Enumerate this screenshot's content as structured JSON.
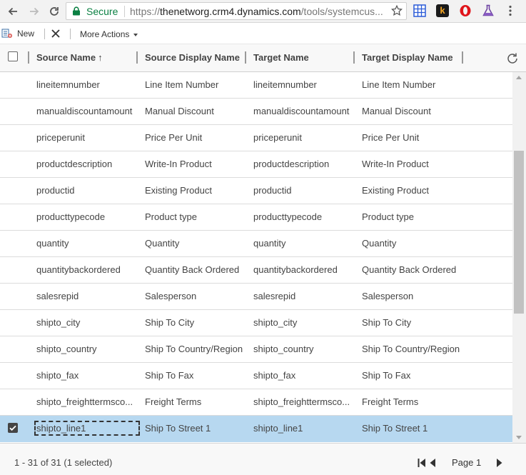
{
  "browser": {
    "security_label": "Secure",
    "url_scheme": "https://",
    "url_host": "thenetworg.crm4.dynamics.com",
    "url_path": "/tools/systemcus..."
  },
  "command_bar": {
    "new_label": "New",
    "more_actions_label": "More Actions"
  },
  "grid": {
    "columns": [
      {
        "label": "Source Name",
        "sort": "↑"
      },
      {
        "label": "Source Display Name"
      },
      {
        "label": "Target Name"
      },
      {
        "label": "Target Display Name"
      }
    ],
    "rows": [
      {
        "source_name": "lineitemnumber",
        "source_display": "Line Item Number",
        "target_name": "lineitemnumber",
        "target_display": "Line Item Number",
        "selected": false
      },
      {
        "source_name": "manualdiscountamount",
        "source_display": "Manual Discount",
        "target_name": "manualdiscountamount",
        "target_display": "Manual Discount",
        "selected": false
      },
      {
        "source_name": "priceperunit",
        "source_display": "Price Per Unit",
        "target_name": "priceperunit",
        "target_display": "Price Per Unit",
        "selected": false
      },
      {
        "source_name": "productdescription",
        "source_display": "Write-In Product",
        "target_name": "productdescription",
        "target_display": "Write-In Product",
        "selected": false
      },
      {
        "source_name": "productid",
        "source_display": "Existing Product",
        "target_name": "productid",
        "target_display": "Existing Product",
        "selected": false
      },
      {
        "source_name": "producttypecode",
        "source_display": "Product type",
        "target_name": "producttypecode",
        "target_display": "Product type",
        "selected": false
      },
      {
        "source_name": "quantity",
        "source_display": "Quantity",
        "target_name": "quantity",
        "target_display": "Quantity",
        "selected": false
      },
      {
        "source_name": "quantitybackordered",
        "source_display": "Quantity Back Ordered",
        "target_name": "quantitybackordered",
        "target_display": "Quantity Back Ordered",
        "selected": false
      },
      {
        "source_name": "salesrepid",
        "source_display": "Salesperson",
        "target_name": "salesrepid",
        "target_display": "Salesperson",
        "selected": false
      },
      {
        "source_name": "shipto_city",
        "source_display": "Ship To City",
        "target_name": "shipto_city",
        "target_display": "Ship To City",
        "selected": false
      },
      {
        "source_name": "shipto_country",
        "source_display": "Ship To Country/Region",
        "target_name": "shipto_country",
        "target_display": "Ship To Country/Region",
        "selected": false
      },
      {
        "source_name": "shipto_fax",
        "source_display": "Ship To Fax",
        "target_name": "shipto_fax",
        "target_display": "Ship To Fax",
        "selected": false
      },
      {
        "source_name": "shipto_freighttermsco...",
        "source_display": "Freight Terms",
        "target_name": "shipto_freighttermsco...",
        "target_display": "Freight Terms",
        "selected": false
      },
      {
        "source_name": "shipto_line1",
        "source_display": "Ship To Street 1",
        "target_name": "shipto_line1",
        "target_display": "Ship To Street 1",
        "selected": true
      }
    ]
  },
  "footer": {
    "status": "1 - 31 of 31 (1 selected)",
    "page_label": "Page 1"
  },
  "colors": {
    "selected_row": "#b7d8f0",
    "secure_green": "#0b8043"
  },
  "icons": [
    "back-arrow-icon",
    "forward-arrow-icon",
    "reload-icon",
    "lock-icon",
    "star-icon",
    "grid-extension-icon",
    "k-extension-icon",
    "opera-icon",
    "flask-icon",
    "menu-dots-icon",
    "new-record-icon",
    "delete-icon",
    "refresh-icon",
    "first-page-icon",
    "previous-page-icon",
    "next-page-icon",
    "checkmark-icon"
  ]
}
